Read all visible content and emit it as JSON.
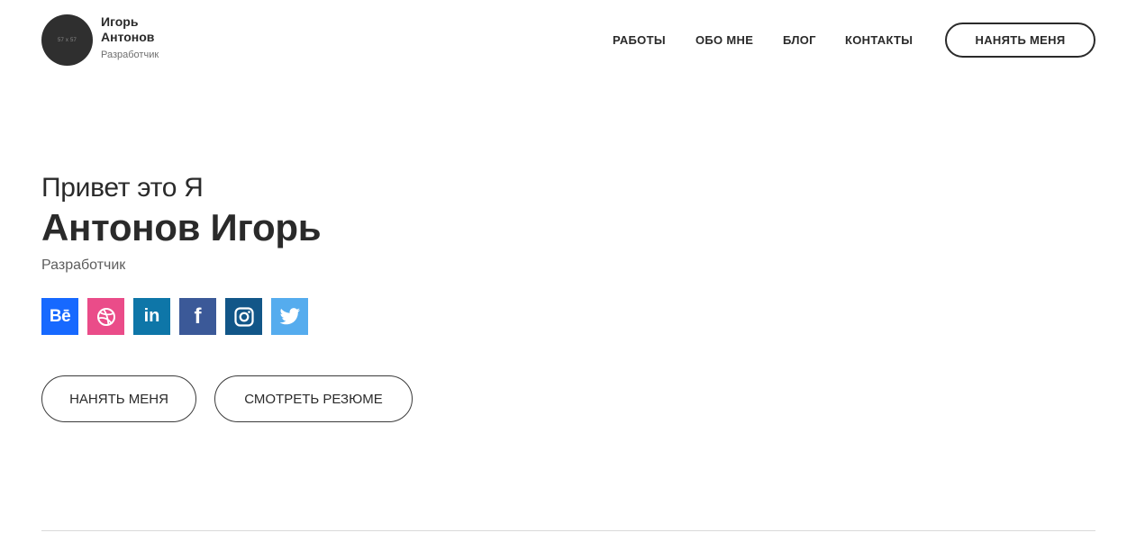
{
  "header": {
    "avatar_placeholder": "57 x 57",
    "brand_name": "Игорь Антонов",
    "brand_role": "Разработчик",
    "nav": [
      {
        "label": "РАБОТЫ"
      },
      {
        "label": "ОБО МНЕ"
      },
      {
        "label": "БЛОГ"
      },
      {
        "label": "КОНТАКТЫ"
      }
    ],
    "hire_button": "НАНЯТЬ МЕНЯ"
  },
  "hero": {
    "greeting": "Привет это Я",
    "name": "Антонов Игорь",
    "role": "Разработчик",
    "socials": [
      {
        "name": "behance-icon",
        "label": "Bē",
        "color": "#1769ff"
      },
      {
        "name": "dribbble-icon",
        "color": "#ea4c89"
      },
      {
        "name": "linkedin-icon",
        "label": "in",
        "color": "#0e76a8"
      },
      {
        "name": "facebook-icon",
        "label": "f",
        "color": "#3b5998"
      },
      {
        "name": "instagram-icon",
        "color": "#125688"
      },
      {
        "name": "twitter-icon",
        "color": "#55acee"
      }
    ],
    "hire_button": "НАНЯТЬ МЕНЯ",
    "resume_button": "СМОТРЕТЬ РЕЗЮМЕ"
  }
}
